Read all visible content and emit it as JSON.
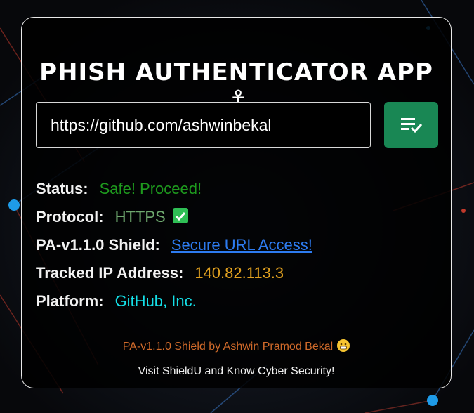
{
  "app": {
    "title": "Phish Authenticator App",
    "title_icon": "anchor-icon"
  },
  "search": {
    "value": "https://github.com/ashwinbekal",
    "button_icon": "checklist-icon",
    "button_color": "#198754"
  },
  "details": {
    "status_label": "Status:",
    "status_value": "Safe! Proceed!",
    "protocol_label": "Protocol:",
    "protocol_value": "HTTPS",
    "protocol_icon": "check-box-icon",
    "shield_label": "PA-v1.1.0 Shield:",
    "shield_value": "Secure URL Access!",
    "ip_label": "Tracked IP Address:",
    "ip_value": "140.82.113.3",
    "platform_label": "Platform:",
    "platform_value": "GitHub, Inc."
  },
  "footer": {
    "credit": "PA-v1.1.0 Shield by Ashwin Pramod Bekal",
    "credit_icon": "grinning-face-icon",
    "tagline": "Visit ShieldU and Know Cyber Security!"
  },
  "colors": {
    "status": "#1e9a1e",
    "link": "#2d7bf0",
    "ip": "#e0a020",
    "platform": "#14e0e8",
    "credit": "#d06a2a"
  }
}
